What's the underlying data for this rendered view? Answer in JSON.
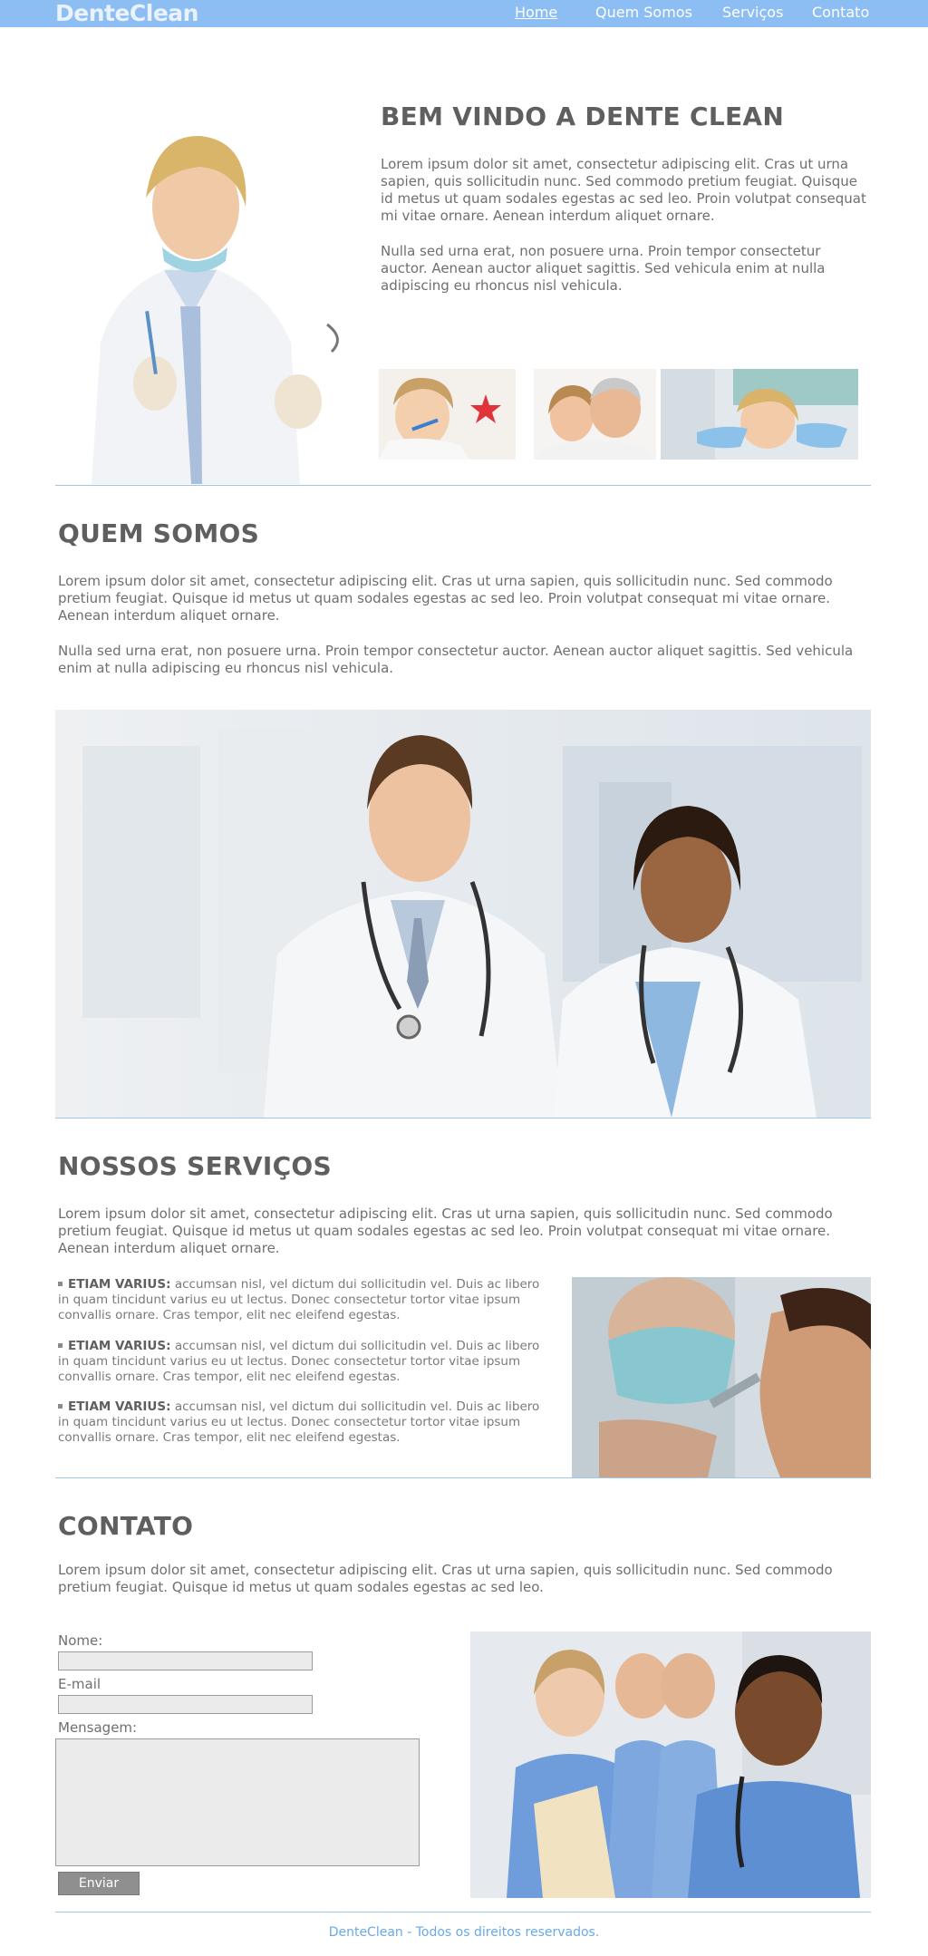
{
  "nav": {
    "logo": "DenteClean",
    "links": [
      {
        "label": "Home"
      },
      {
        "label": "Quem Somos"
      },
      {
        "label": "Serviços"
      },
      {
        "label": "Contato"
      }
    ]
  },
  "hero": {
    "title": "BEM VINDO A DENTE CLEAN",
    "p1": "Lorem ipsum dolor sit amet, consectetur adipiscing elit. Cras ut urna sapien, quis sollicitudin nunc. Sed commodo pretium feugiat. Quisque id metus ut quam sodales egestas ac sed leo. Proin volutpat consequat mi vitae ornare. Aenean interdum aliquet ornare.",
    "p2": "Nulla sed urna erat, non posuere urna. Proin tempor consectetur auctor. Aenean auctor aliquet sagittis. Sed vehicula enim at nulla adipiscing eu rhoncus nisl vehicula."
  },
  "about": {
    "title": "QUEM SOMOS",
    "p1": "Lorem ipsum dolor sit amet, consectetur adipiscing elit. Cras ut urna sapien, quis sollicitudin nunc. Sed commodo pretium feugiat. Quisque id metus ut quam sodales egestas ac sed leo. Proin volutpat consequat mi vitae ornare. Aenean interdum aliquet ornare.",
    "p2": "Nulla sed urna erat, non posuere urna. Proin tempor consectetur auctor. Aenean auctor aliquet sagittis. Sed vehicula enim at nulla adipiscing eu rhoncus nisl vehicula."
  },
  "services": {
    "title": "NOSSOS SERVIÇOS",
    "p1": "Lorem ipsum dolor sit amet, consectetur adipiscing elit. Cras ut urna sapien, quis sollicitudin nunc. Sed commodo pretium feugiat. Quisque id metus ut quam sodales egestas ac sed leo. Proin volutpat consequat mi vitae ornare. Aenean interdum aliquet ornare.",
    "items": [
      {
        "title": "ETIAM VARIUS:",
        "text": "accumsan nisl, vel dictum dui sollicitudin vel. Duis ac libero in quam tincidunt varius eu ut lectus. Donec consectetur tortor vitae ipsum convallis ornare. Cras tempor, elit nec eleifend egestas."
      },
      {
        "title": "ETIAM VARIUS:",
        "text": "accumsan nisl, vel dictum dui sollicitudin vel. Duis ac libero in quam tincidunt varius eu ut lectus. Donec consectetur tortor vitae ipsum convallis ornare. Cras tempor, elit nec eleifend egestas."
      },
      {
        "title": "ETIAM VARIUS:",
        "text": "accumsan nisl, vel dictum dui sollicitudin vel. Duis ac libero in quam tincidunt varius eu ut lectus. Donec consectetur tortor vitae ipsum convallis ornare. Cras tempor, elit nec eleifend egestas."
      }
    ]
  },
  "contact": {
    "title": "CONTATO",
    "p1": "Lorem ipsum dolor sit amet, consectetur adipiscing elit. Cras ut urna sapien, quis sollicitudin nunc. Sed commodo pretium feugiat. Quisque id metus ut quam sodales egestas ac sed leo.",
    "name_label": "Nome:",
    "email_label": "E-mail",
    "message_label": "Mensagem:",
    "submit_label": "Enviar"
  },
  "footer": {
    "text": "DenteClean - Todos os direitos reservados."
  },
  "colors": {
    "nav": "#8cbdf3",
    "rule": "#9cc6ec",
    "footer_text": "#6aa9e6"
  }
}
